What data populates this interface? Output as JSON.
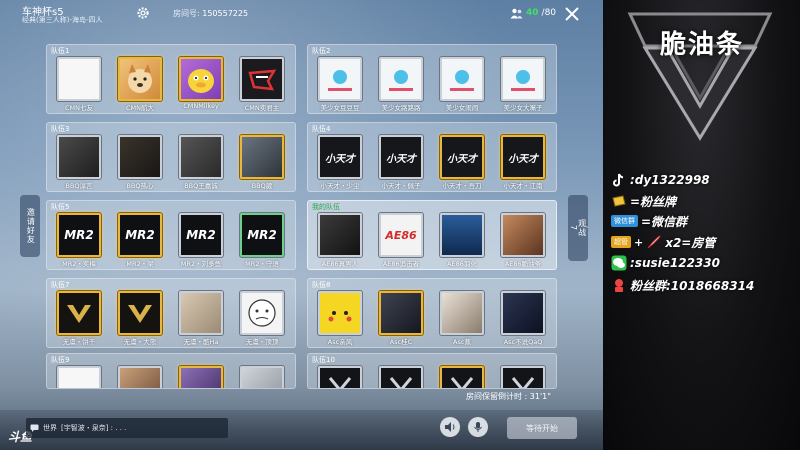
{
  "header": {
    "title": "车神杯s5",
    "subtitle": "经典(第三人称)-海岛-四人",
    "room_label": "房间号:",
    "room_number": "150557225",
    "player_current": "40",
    "player_max": "/80"
  },
  "side_buttons": {
    "invite": "邀请好友",
    "watch": "观战",
    "watch_count": "7"
  },
  "teams": [
    {
      "label": "队伍1",
      "players": [
        "CMN七友",
        "CMN航大",
        "CMNMilkey",
        "CMN奕君主"
      ]
    },
    {
      "label": "队伍2",
      "players": [
        "美少女豆豆豆",
        "美少女路路路",
        "美少女闹闹",
        "美少女大嘴子"
      ]
    },
    {
      "label": "队伍3",
      "players": [
        "BBQ淳言",
        "BBQ热心",
        "BBQ王嘉诚",
        "BBQ葳"
      ]
    },
    {
      "label": "队伍4",
      "players": [
        "小天才・少尘",
        "小天才・佩子",
        "小天才・吾刀",
        "小天才・江南"
      ]
    },
    {
      "label": "队伍5",
      "players": [
        "MR2・奕梅",
        "MR2・梁",
        "MR2・刘多鱼",
        "MR2・守语"
      ]
    },
    {
      "label": "我的队伍",
      "players": [
        "AE86真男人",
        "AE86追击者",
        "AE86羽化",
        "AE86脆油条"
      ]
    },
    {
      "label": "队伍7",
      "players": [
        "无虞・饼干",
        "无虞・大熊",
        "无虞・酷Ha",
        "无虞・顶顶"
      ]
    },
    {
      "label": "队伍8",
      "players": [
        "Asc亲风",
        "Asc桂C",
        "Asc蕉",
        "Asc不说QaQ"
      ]
    },
    {
      "label": "队伍9",
      "players": [
        "",
        "",
        "",
        ""
      ]
    },
    {
      "label": "队伍10",
      "players": [
        "",
        "",
        "",
        ""
      ]
    }
  ],
  "avatar_texts": {
    "mr2": "MR2",
    "xtc": "小天才",
    "ae86": "AE86"
  },
  "bottom": {
    "countdown": "房间保留倒计时 : 31'1\"",
    "chat_channel": "世界",
    "chat_message": "[宇智波・泉奈] : . . .",
    "start_button": "等待开始",
    "douyu": "斗鱼"
  },
  "panel": {
    "brand": "脆油条",
    "tiktok": ":dy1322998",
    "fan_badge": "=粉丝牌",
    "wechat_group_tag": "微信群",
    "wechat_group": "=微信群",
    "room_admin_tag": "超管",
    "room_admin": "x2=房管",
    "wechat_id": ":susie122330",
    "fan_group": "粉丝群:1018668314"
  },
  "colors": {
    "gold_frame": "#e6b93c",
    "online_count": "#3ee06a",
    "my_team_label": "#2aa84a"
  }
}
